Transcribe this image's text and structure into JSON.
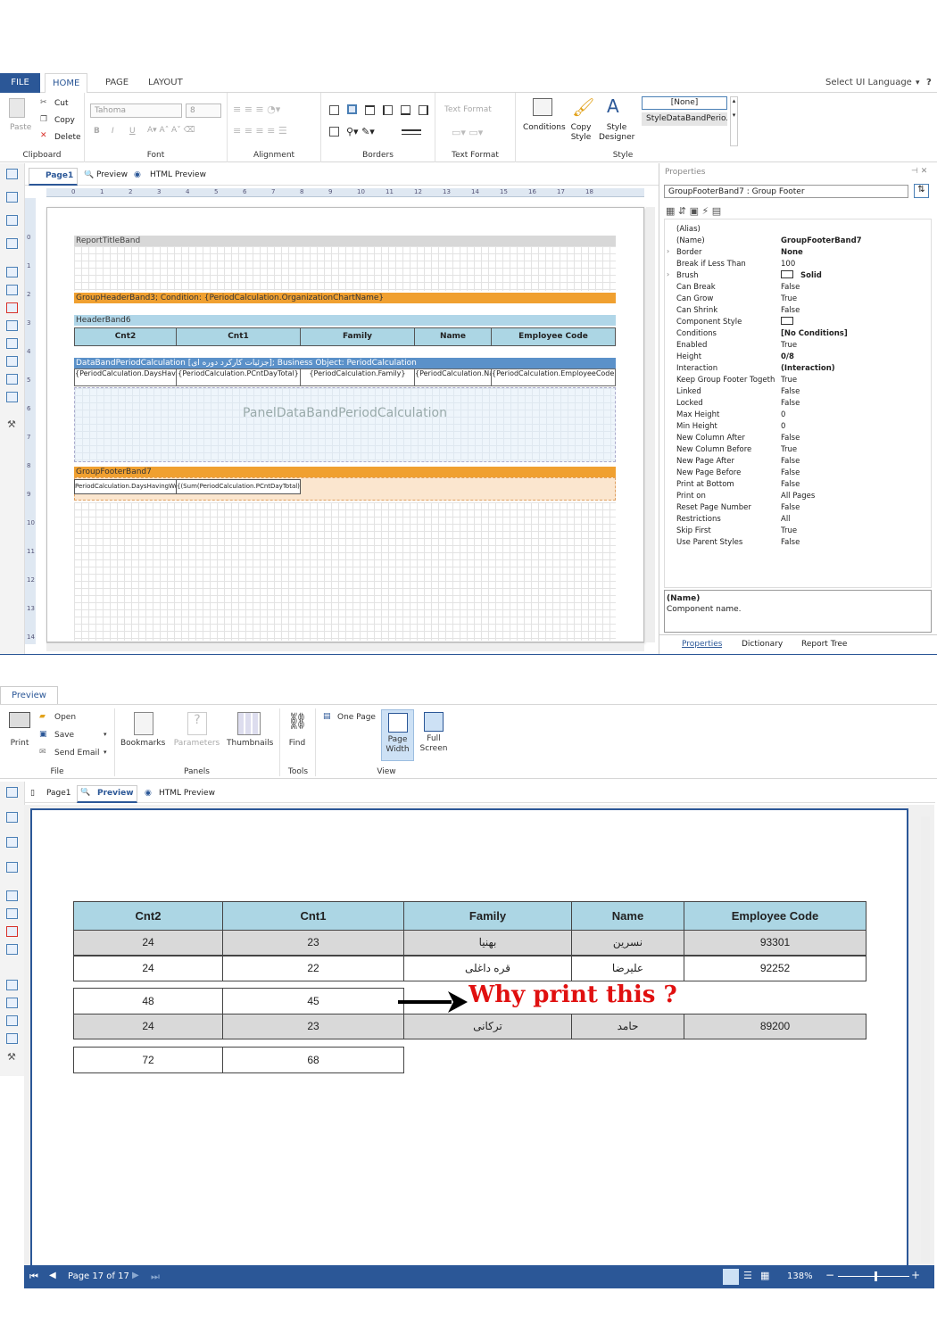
{
  "menubar": {
    "tabs": [
      "FILE",
      "HOME",
      "PAGE",
      "LAYOUT"
    ],
    "language": "Select UI Language",
    "help": "?"
  },
  "ribbon": {
    "clipboard": {
      "paste": "Paste",
      "cut": "Cut",
      "copy": "Copy",
      "delete": "Delete",
      "label": "Clipboard"
    },
    "font": {
      "family": "Tahoma",
      "size": "8",
      "label": "Font",
      "bold": "B",
      "italic": "I",
      "underline": "U"
    },
    "alignment": {
      "label": "Alignment"
    },
    "borders": {
      "label": "Borders"
    },
    "text_format": {
      "value": "Text Format",
      "label": "Text Format"
    },
    "style": {
      "conditions": "Conditions",
      "copy_style": "Copy Style",
      "style_designer": "Style Designer",
      "style_none": "[None]",
      "style_item": "StyleDataBandPerio...",
      "label": "Style"
    }
  },
  "doc_tabs": [
    "Page1",
    "Preview",
    "HTML Preview"
  ],
  "ruler": [
    "0",
    "1",
    "2",
    "3",
    "4",
    "5",
    "6",
    "7",
    "8",
    "9",
    "10",
    "11",
    "12",
    "13",
    "14",
    "15",
    "16",
    "17",
    "18"
  ],
  "vruler": [
    "0",
    "1",
    "2",
    "3",
    "4",
    "5",
    "6",
    "7",
    "8",
    "9",
    "10",
    "11",
    "12",
    "13",
    "14"
  ],
  "bands": {
    "report_title": "ReportTitleBand",
    "group_header": "GroupHeaderBand3; Condition: {PeriodCalculation.OrganizationChartName}",
    "header": "HeaderBand6",
    "header_cells": [
      "Cnt2",
      "Cnt1",
      "Family",
      "Name",
      "Employee Code"
    ],
    "data_band": "DataBandPeriodCalculation  [جزئیات کارکرد دوره ای]; Business Object: PeriodCalculation",
    "data_cells": [
      "{PeriodCalculation.DaysHavingWorkCount}",
      "{PeriodCalculation.PCntDayTotal}",
      "{PeriodCalculation.Family}",
      "{PeriodCalculation.Name}",
      "{PeriodCalculation.EmployeeCode}"
    ],
    "panel": "PanelDataBandPeriodCalculation",
    "group_footer": "GroupFooterBand7",
    "footer_cells": [
      "PeriodCalculation.DaysHavingWor",
      "{(Sum(PeriodCalculation.PCntDayTotal)}"
    ]
  },
  "properties": {
    "title": "Properties",
    "selector": "GroupFooterBand7 : Group Footer",
    "rows": [
      {
        "name": "(Alias)",
        "value": ""
      },
      {
        "name": "(Name)",
        "value": "GroupFooterBand7"
      },
      {
        "name": "Border",
        "value": "None"
      },
      {
        "name": "Break if Less Than",
        "value": "100"
      },
      {
        "name": "Brush",
        "value": "Solid"
      },
      {
        "name": "Can Break",
        "value": "False"
      },
      {
        "name": "Can Grow",
        "value": "True"
      },
      {
        "name": "Can Shrink",
        "value": "False"
      },
      {
        "name": "Component Style",
        "value": ""
      },
      {
        "name": "Conditions",
        "value": "[No Conditions]"
      },
      {
        "name": "Enabled",
        "value": "True"
      },
      {
        "name": "Height",
        "value": "0/8"
      },
      {
        "name": "Interaction",
        "value": "(Interaction)"
      },
      {
        "name": "Keep Group Footer Togeth",
        "value": "True"
      },
      {
        "name": "Linked",
        "value": "False"
      },
      {
        "name": "Locked",
        "value": "False"
      },
      {
        "name": "Max Height",
        "value": "0"
      },
      {
        "name": "Min Height",
        "value": "0"
      },
      {
        "name": "New Column After",
        "value": "False"
      },
      {
        "name": "New Column Before",
        "value": "True"
      },
      {
        "name": "New Page After",
        "value": "False"
      },
      {
        "name": "New Page Before",
        "value": "False"
      },
      {
        "name": "Print at Bottom",
        "value": "False"
      },
      {
        "name": "Print on",
        "value": "All Pages"
      },
      {
        "name": "Reset Page Number",
        "value": "False"
      },
      {
        "name": "Restrictions",
        "value": "All"
      },
      {
        "name": "Skip First",
        "value": "True"
      },
      {
        "name": "Use Parent Styles",
        "value": "False"
      }
    ],
    "desc_title": "(Name)",
    "desc_text": "Component name.",
    "bottom_tabs": [
      "Properties",
      "Dictionary",
      "Report Tree"
    ]
  },
  "preview": {
    "tab": "Preview",
    "buttons": {
      "print": "Print",
      "open": "Open",
      "save": "Save",
      "send_email": "Send Email",
      "bookmarks": "Bookmarks",
      "parameters": "Parameters",
      "thumbnails": "Thumbnails",
      "find": "Find",
      "one_page": "One Page",
      "page_width": "Page Width",
      "full_screen": "Full Screen"
    },
    "groups": [
      "File",
      "Panels",
      "Tools",
      "View"
    ],
    "tabs": [
      "Page1",
      "Preview",
      "HTML Preview"
    ],
    "table_header": [
      "Cnt2",
      "Cnt1",
      "Family",
      "Name",
      "Employee Code"
    ],
    "rows1": [
      [
        "24",
        "23",
        "بهنیا",
        "نسرین",
        "93301"
      ],
      [
        "24",
        "22",
        "قره داغلی",
        "علیرضا",
        "92252"
      ]
    ],
    "sum1": [
      "48",
      "45"
    ],
    "rows2": [
      [
        "24",
        "23",
        "ترکانی",
        "حامد",
        "89200"
      ]
    ],
    "sum2": [
      "72",
      "68"
    ],
    "annotation": "Why print this ?",
    "status": {
      "page": "Page 17 of 17",
      "zoom": "138%"
    }
  }
}
